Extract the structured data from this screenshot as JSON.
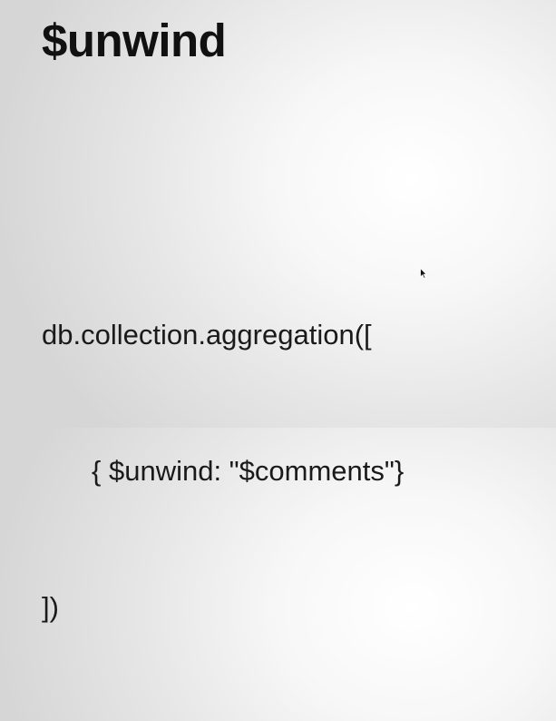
{
  "slide": {
    "title": "$unwind",
    "code_lines": [
      "db.collection.aggregation([",
      "{ $unwind: \"$comments\"}",
      "])"
    ]
  },
  "cursor_icon": "mouse-pointer-icon"
}
